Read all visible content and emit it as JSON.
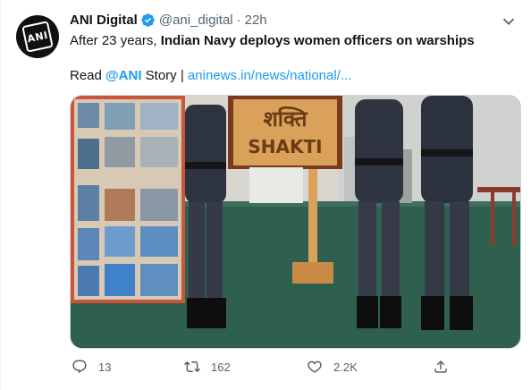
{
  "tweet": {
    "author": {
      "display_name": "ANI Digital",
      "handle": "@ani_digital",
      "time": "22h",
      "avatar_text": "ANI"
    },
    "text_prefix": "After 23 years, ",
    "text_bold": "Indian Navy deploys women officers on warships",
    "read_prefix": "Read ",
    "mention": "@ANI",
    "read_suffix": " Story | ",
    "link": "aninews.in/news/national/...",
    "media_sign": {
      "hindi": "शक्ति",
      "english": "SHAKTI"
    },
    "actions": {
      "replies": "13",
      "retweets": "162",
      "likes": "2.2K"
    },
    "colors": {
      "accent": "#1d9bf0",
      "muted": "#536471"
    }
  }
}
